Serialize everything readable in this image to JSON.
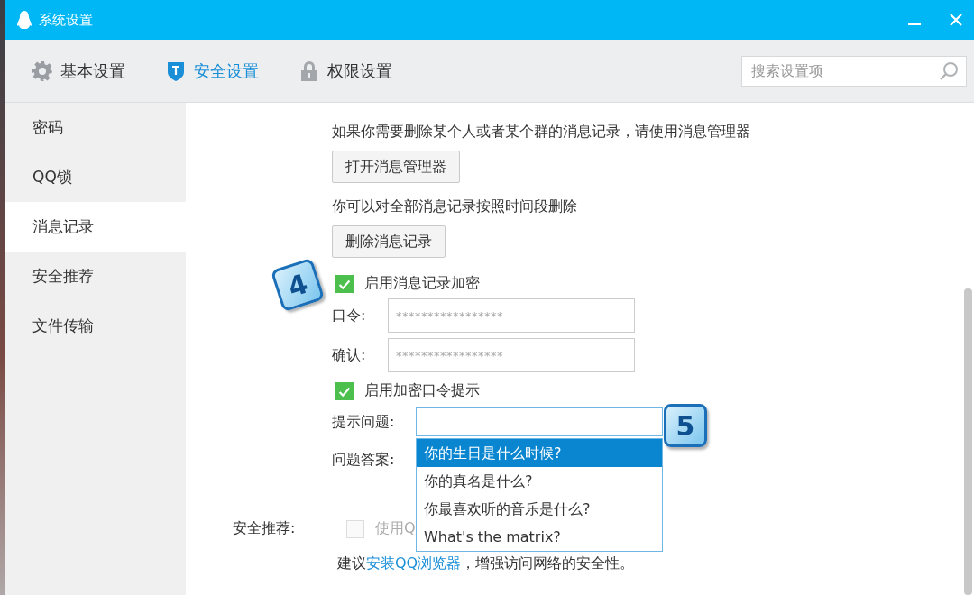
{
  "window": {
    "title": "系统设置"
  },
  "tabs": [
    {
      "label": "基本设置",
      "kind": "gear",
      "selected": false
    },
    {
      "label": "安全设置",
      "kind": "shield",
      "selected": true
    },
    {
      "label": "权限设置",
      "kind": "lock",
      "selected": false
    }
  ],
  "search": {
    "placeholder": "搜索设置项"
  },
  "sidebar": {
    "items": [
      {
        "label": "密码",
        "selected": false
      },
      {
        "label": "QQ锁",
        "selected": false
      },
      {
        "label": "消息记录",
        "selected": true
      },
      {
        "label": "安全推荐",
        "selected": false
      },
      {
        "label": "文件传输",
        "selected": false
      }
    ]
  },
  "content": {
    "manager_hint": "如果你需要删除某个人或者某个群的消息记录，请使用消息管理器",
    "manager_button": "打开消息管理器",
    "delete_hint": "你可以对全部消息记录按照时间段删除",
    "delete_button": "删除消息记录",
    "encrypt_checkbox": {
      "label": "启用消息记录加密",
      "checked": true
    },
    "password_fields": [
      {
        "label": "口令:",
        "value": "*****************"
      },
      {
        "label": "确认:",
        "value": "*****************"
      }
    ],
    "hint_checkbox": {
      "label": "启用加密口令提示",
      "checked": true
    },
    "question": {
      "label": "提示问题:",
      "options": [
        {
          "label": "你的生日是什么时候?",
          "selected": true
        },
        {
          "label": "你的真名是什么?",
          "selected": false
        },
        {
          "label": "你最喜欢听的音乐是什么?",
          "selected": false
        },
        {
          "label": "What's the matrix?",
          "selected": false
        }
      ]
    },
    "answer": {
      "label": "问题答案:"
    },
    "recommend": {
      "label": "安全推荐:",
      "checkbox": {
        "label": "使用Q",
        "checked": false,
        "disabled": true
      },
      "tip_before": "建议",
      "tip_link": "安装QQ浏览器",
      "tip_after": "，增强访问网络的安全性。"
    }
  },
  "callouts": [
    "4",
    "5"
  ]
}
